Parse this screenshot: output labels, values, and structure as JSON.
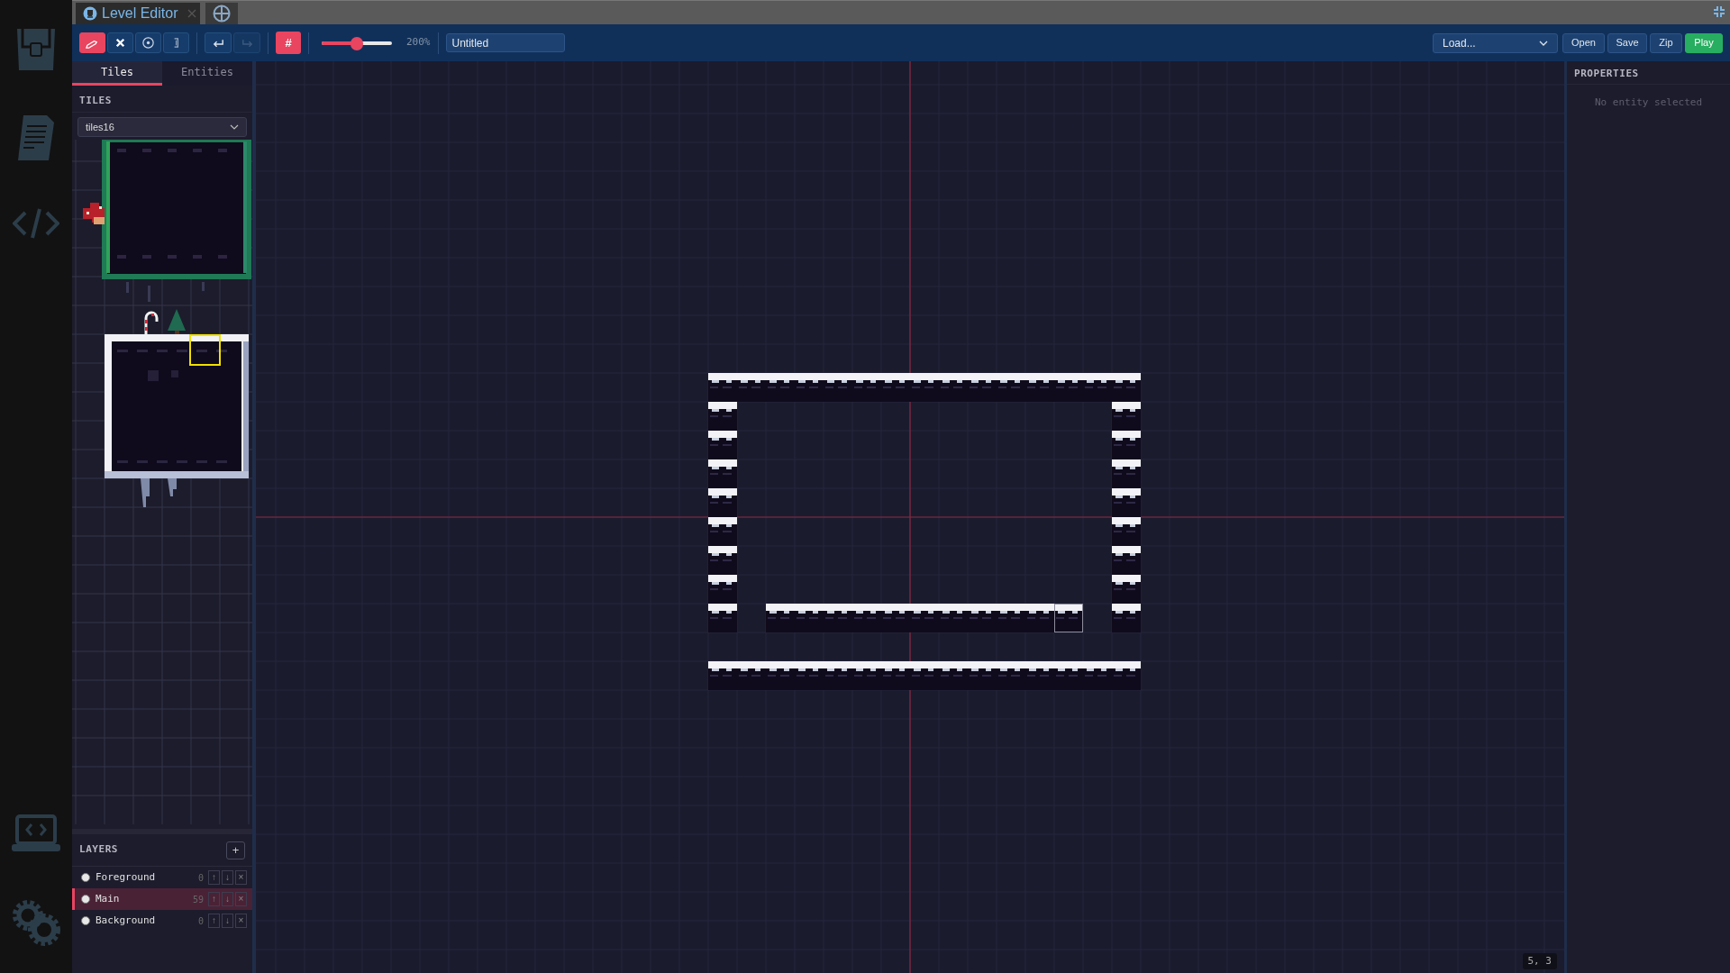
{
  "tabs": [
    {
      "label": "Level Editor",
      "selected": true
    }
  ],
  "toolbar": {
    "tools": [
      {
        "kind": "pencil",
        "selected": true
      },
      {
        "kind": "cross",
        "selected": false
      },
      {
        "kind": "target",
        "selected": false
      },
      {
        "kind": "bracket",
        "selected": false
      }
    ],
    "history": [
      {
        "kind": "undo",
        "disabled": false
      },
      {
        "kind": "redo",
        "disabled": true
      }
    ],
    "grid_toggle": {
      "label": "#",
      "on": true
    },
    "zoom": {
      "level": 0.5,
      "reading": "200%"
    },
    "level_name": {
      "value": "Untitled"
    },
    "load_select": {
      "value": "Load..."
    },
    "buttons": [
      {
        "label": "Open",
        "kind": "plain"
      },
      {
        "label": "Save",
        "kind": "plain"
      },
      {
        "label": "Zip",
        "kind": "plain"
      },
      {
        "label": "Play",
        "kind": "primary"
      }
    ]
  },
  "left_panel": {
    "tabs": [
      {
        "label": "Tiles",
        "selected": true
      },
      {
        "label": "Entities",
        "selected": false
      }
    ],
    "tiles_title": "TILES",
    "tileset": {
      "value": "tiles16"
    },
    "layers": {
      "title": "LAYERS",
      "add_label": "+",
      "items": [
        {
          "name": "Foreground",
          "count": "0",
          "selected": false,
          "actions": [
            "↑",
            "↓",
            "×"
          ]
        },
        {
          "name": "Main",
          "count": "59",
          "selected": true,
          "actions": [
            "↑",
            "↓",
            "×"
          ]
        },
        {
          "name": "Background",
          "count": "0",
          "selected": false,
          "actions": [
            "↑",
            "↓",
            "×"
          ]
        }
      ]
    }
  },
  "properties": {
    "title": "PROPERTIES",
    "empty_text": "No entity selected"
  },
  "status": {
    "coordinates": "5, 3"
  }
}
